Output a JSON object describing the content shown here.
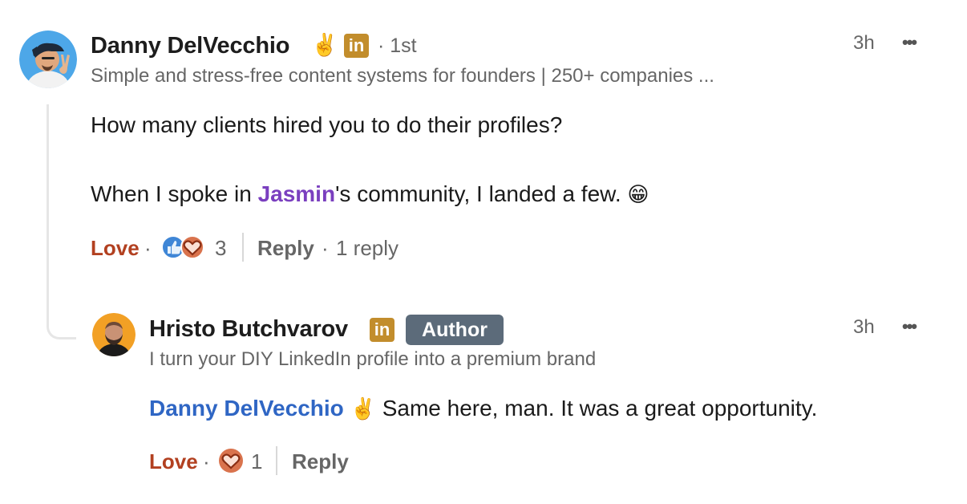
{
  "comment": {
    "author": "Danny DelVecchio",
    "author_emoji": "✌️",
    "linkedin_badge": "in",
    "connection": "· 1st",
    "headline": "Simple and stress-free content systems for founders | 250+ companies ...",
    "time": "3h",
    "more": "•••",
    "text_line1": "How many clients hired you to do their profiles?",
    "text_line2_pre": "When I spoke in ",
    "mention": "Jasmin",
    "text_line2_post": "'s community, I landed a few.",
    "text_emoji": "😁",
    "actions": {
      "love": "Love",
      "dot1": "·",
      "reaction_count": "3",
      "reply": "Reply",
      "dot2": "·",
      "replies": "1 reply"
    }
  },
  "reply": {
    "author": "Hristo Butchvarov",
    "linkedin_badge": "in",
    "badge": "Author",
    "headline": "I turn your DIY LinkedIn profile into a premium brand",
    "time": "3h",
    "more": "•••",
    "mention": "Danny DelVecchio",
    "mention_emoji": "✌️",
    "text": "Same here, man. It was a great opportunity.",
    "actions": {
      "love": "Love",
      "dot": "·",
      "reaction_count": "1",
      "reply": "Reply"
    }
  },
  "colors": {
    "love": "#b24020",
    "mention_purple": "#7a3fbf",
    "mention_blue": "#2f66c4",
    "linkedin_badge": "#c28d2c",
    "author_badge": "#5c6b7a"
  }
}
